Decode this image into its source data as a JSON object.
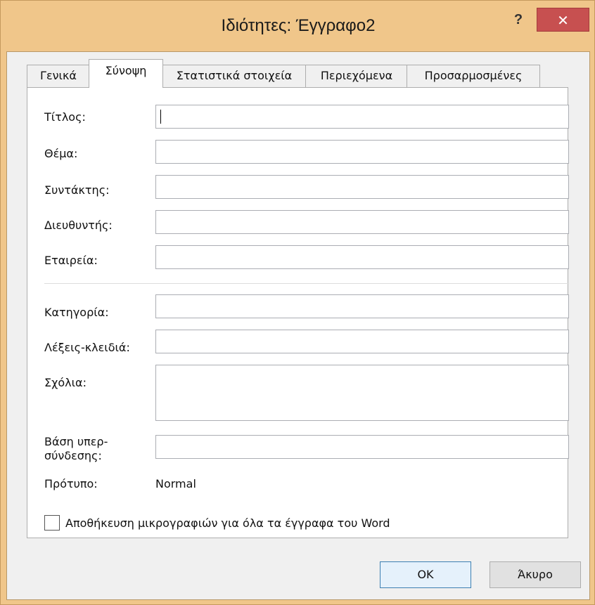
{
  "window": {
    "title": "Ιδιότητες: Έγγραφο2",
    "help_label": "?",
    "close_label": "✕"
  },
  "tabs": [
    {
      "label": "Γενικά",
      "active": false
    },
    {
      "label": "Σύνοψη",
      "active": true
    },
    {
      "label": "Στατιστικά στοιχεία",
      "active": false
    },
    {
      "label": "Περιεχόμενα",
      "active": false
    },
    {
      "label": "Προσαρμοσμένες",
      "active": false
    }
  ],
  "summary": {
    "title_label": "Τίτλος:",
    "title_value": "",
    "subject_label": "Θέμα:",
    "subject_value": "",
    "author_label": "Συντάκτης:",
    "author_value": "",
    "manager_label": "Διευθυντής:",
    "manager_value": "",
    "company_label": "Εταιρεία:",
    "company_value": "",
    "category_label": "Κατηγορία:",
    "category_value": "",
    "keywords_label": "Λέξεις-κλειδιά:",
    "keywords_value": "",
    "comments_label": "Σχόλια:",
    "comments_value": "",
    "hyperlink_label_1": "Βάση υπερ-",
    "hyperlink_label_2": "σύνδεσης:",
    "hyperlink_value": "",
    "template_label": "Πρότυπο:",
    "template_value": "Normal",
    "thumbnails_label": "Αποθήκευση μικρογραφιών για όλα τα έγγραφα του Word",
    "thumbnails_checked": false
  },
  "buttons": {
    "ok": "OK",
    "cancel": "Άκυρο"
  },
  "colors": {
    "frame": "#f0c68a",
    "close": "#c75050",
    "default_button_border": "#3c7fb1"
  }
}
